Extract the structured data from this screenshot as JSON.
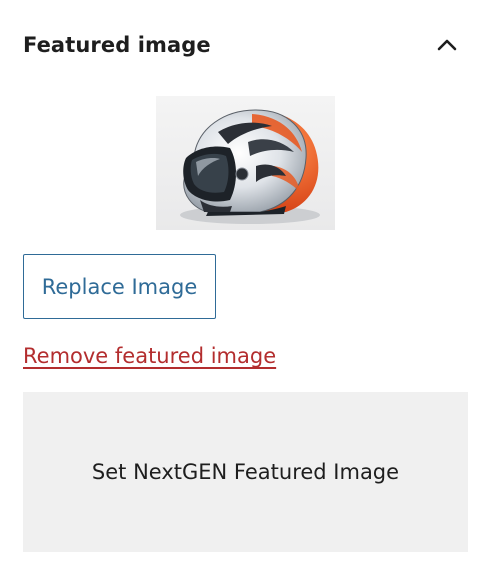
{
  "panel": {
    "title": "Featured image",
    "toggle_icon": "chevron-up-icon"
  },
  "featured_image": {
    "thumbnail_icon": "motorcycle-helmet-image",
    "replace_label": "Replace Image",
    "remove_label": "Remove featured image"
  },
  "nextgen": {
    "label": "Set NextGEN Featured Image"
  },
  "colors": {
    "accent": "#2f6b97",
    "destructive": "#b32d2e",
    "button_bg": "#f0f0f0",
    "text": "#1e1e1e"
  }
}
